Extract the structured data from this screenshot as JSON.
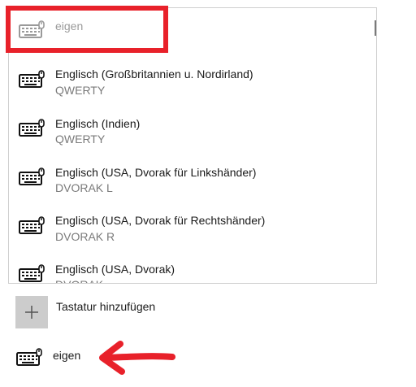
{
  "dropdown": {
    "items": [
      {
        "title": "eigen",
        "subtitle": "",
        "icon": "keyboard-icon",
        "dimmed": true
      },
      {
        "title": "Englisch (Großbritannien u. Nordirland)",
        "subtitle": "QWERTY",
        "icon": "keyboard-icon"
      },
      {
        "title": "Englisch (Indien)",
        "subtitle": "QWERTY",
        "icon": "keyboard-icon"
      },
      {
        "title": "Englisch (USA, Dvorak für Linkshänder)",
        "subtitle": "DVORAK L",
        "icon": "keyboard-icon"
      },
      {
        "title": "Englisch (USA, Dvorak für Rechtshänder)",
        "subtitle": "DVORAK R",
        "icon": "keyboard-icon"
      },
      {
        "title": "Englisch (USA, Dvorak)",
        "subtitle": "DVORAK",
        "icon": "keyboard-icon"
      }
    ]
  },
  "add_keyboard": {
    "label": "Tastatur hinzufügen",
    "icon": "plus-icon"
  },
  "installed_keyboard": {
    "label": "eigen",
    "icon": "keyboard-icon"
  },
  "annotations": {
    "highlight_color": "#e8212a",
    "arrow_color": "#e8212a"
  }
}
